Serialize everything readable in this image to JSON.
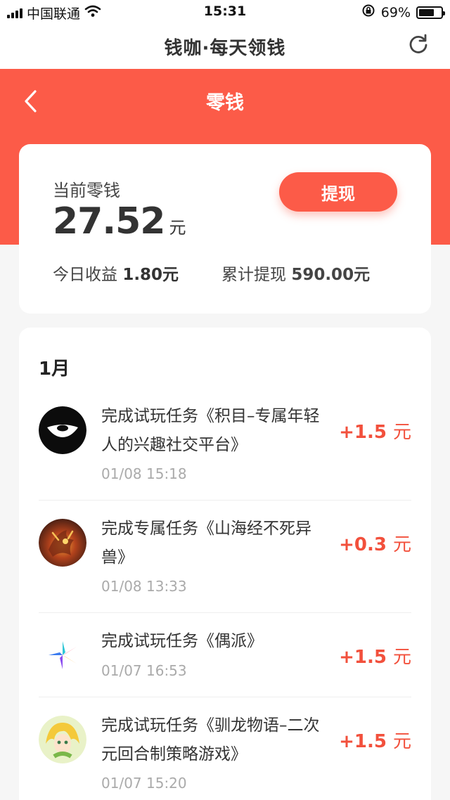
{
  "status_bar": {
    "carrier": "中国联通",
    "time": "15:31",
    "battery": "69%",
    "battery_level": 0.69
  },
  "app_bar": {
    "title": "钱咖·每天领钱"
  },
  "header": {
    "title": "零钱"
  },
  "balance": {
    "label": "当前零钱",
    "amount": "27.52",
    "unit": "元",
    "withdraw_label": "提现",
    "today_label": "今日收益",
    "today_value": "1.80元",
    "total_label": "累计提现",
    "total_value": "590.00元"
  },
  "records": {
    "month": "1月",
    "items": [
      {
        "title": "完成试玩任务《积目–专属年轻人的兴趣社交平台》",
        "time": "01/08 15:18",
        "amount": "+1.5",
        "unit": "元",
        "icon": "jimu-app-icon"
      },
      {
        "title": "完成专属任务《山海经不死异兽》",
        "time": "01/08 13:33",
        "amount": "+0.3",
        "unit": "元",
        "icon": "shanhaijing-game-icon"
      },
      {
        "title": "完成试玩任务《偶派》",
        "time": "01/07 16:53",
        "amount": "+1.5",
        "unit": "元",
        "icon": "oupai-app-icon"
      },
      {
        "title": "完成试玩任务《驯龙物语–二次元回合制策略游戏》",
        "time": "01/07 15:20",
        "amount": "+1.5",
        "unit": "元",
        "icon": "xunlong-game-icon"
      }
    ]
  },
  "colors": {
    "accent": "#fc5b48",
    "amount": "#f2503c"
  }
}
